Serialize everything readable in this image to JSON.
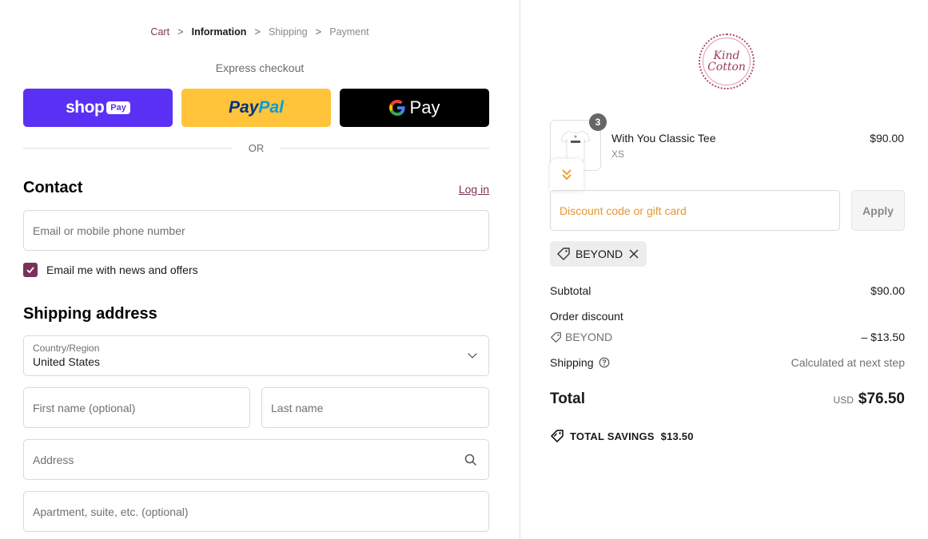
{
  "breadcrumb": {
    "items": [
      "Cart",
      "Information",
      "Shipping",
      "Payment"
    ],
    "separator": ">"
  },
  "express": {
    "title": "Express checkout",
    "shop_word": "shop",
    "shop_badge": "Pay",
    "paypal_1": "Pay",
    "paypal_2": "Pal",
    "gpay_word": "Pay",
    "or": "OR"
  },
  "contact": {
    "title": "Contact",
    "login": "Log in",
    "email_placeholder": "Email or mobile phone number",
    "newsletter_label": "Email me with news and offers",
    "newsletter_checked": true
  },
  "shipping": {
    "title": "Shipping address",
    "country_label": "Country/Region",
    "country_value": "United States",
    "first_name_placeholder": "First name (optional)",
    "last_name_placeholder": "Last name",
    "address_placeholder": "Address",
    "apartment_placeholder": "Apartment, suite, etc. (optional)"
  },
  "summary": {
    "logo_line1": "Kind",
    "logo_line2": "Cotton",
    "item": {
      "quantity": "3",
      "name": "With You Classic Tee",
      "variant": "XS",
      "price": "$90.00"
    },
    "discount_placeholder": "Discount code or gift card",
    "apply": "Apply",
    "applied_code": "BEYOND",
    "subtotal_label": "Subtotal",
    "subtotal_value": "$90.00",
    "order_discount_label": "Order discount",
    "discount_code": "BEYOND",
    "discount_value": "– $13.50",
    "shipping_label": "Shipping",
    "shipping_value": "Calculated at next step",
    "total_label": "Total",
    "total_currency": "USD",
    "total_value": "$76.50",
    "savings_label": "TOTAL SAVINGS",
    "savings_value": "$13.50"
  },
  "colors": {
    "accent": "#7a3356",
    "shop_pay": "#5a31f4",
    "paypal": "#ffc439",
    "gpay": "#000000",
    "discount_placeholder": "#e8962e"
  }
}
